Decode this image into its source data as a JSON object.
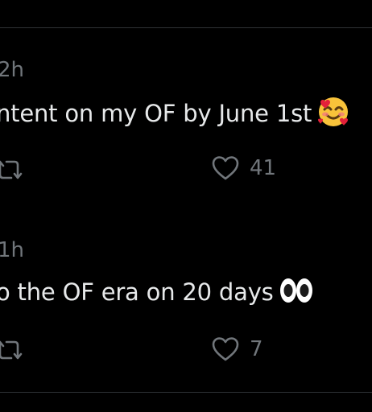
{
  "posts": [
    {
      "timestamp": "2h",
      "text": "ntent on my OF by June 1st",
      "emoji": "smiling-face-with-hearts-icon",
      "likes": "41"
    },
    {
      "timestamp": "1h",
      "text": "o the OF era on 20 days",
      "emoji": "eyes-icon",
      "likes": "7"
    }
  ],
  "colors": {
    "background": "#000000",
    "text": "#e7e9ea",
    "muted": "#71767b",
    "divider": "#2f3336"
  }
}
